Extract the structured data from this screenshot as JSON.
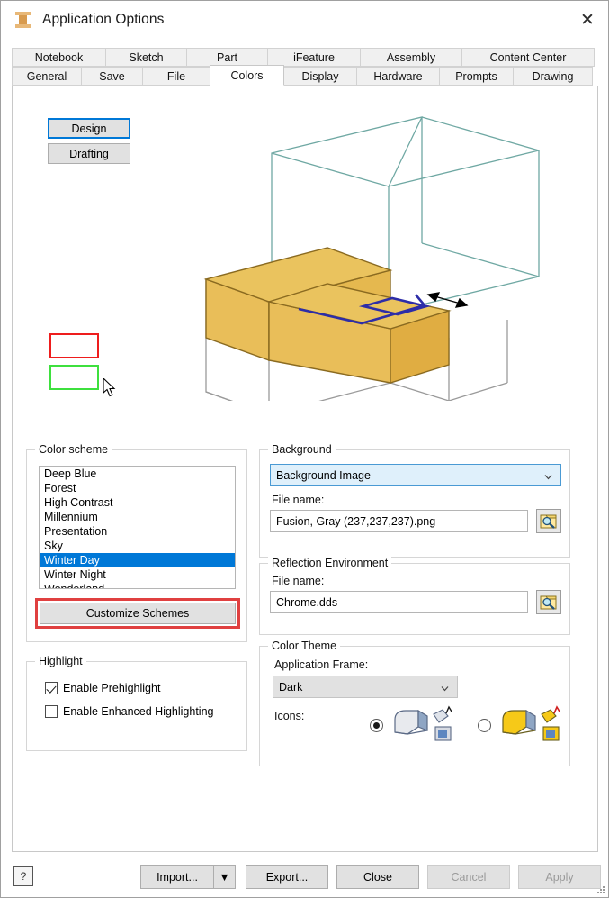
{
  "window": {
    "title": "Application Options",
    "icon": "inventor-ibeam-icon",
    "close_label": "✕"
  },
  "tabs": {
    "row1": [
      {
        "label": "Notebook",
        "active": false
      },
      {
        "label": "Sketch",
        "active": false
      },
      {
        "label": "Part",
        "active": false
      },
      {
        "label": "iFeature",
        "active": false
      },
      {
        "label": "Assembly",
        "active": false
      },
      {
        "label": "Content Center",
        "active": false
      }
    ],
    "row2": [
      {
        "label": "General",
        "active": false
      },
      {
        "label": "Save",
        "active": false
      },
      {
        "label": "File",
        "active": false
      },
      {
        "label": "Colors",
        "active": true
      },
      {
        "label": "Display",
        "active": false
      },
      {
        "label": "Hardware",
        "active": false
      },
      {
        "label": "Prompts",
        "active": false
      },
      {
        "label": "Drawing",
        "active": false
      }
    ]
  },
  "mode_buttons": {
    "design": "Design",
    "drafting": "Drafting"
  },
  "preview": {
    "solid_color": "#e9be59",
    "solid_edge_color": "#8a6a20",
    "wire_teal_color": "#6fa8a3",
    "wire_grey_color": "#9a9a9a",
    "sketch_color": "#2d2da8",
    "dimension_color": "#000000"
  },
  "swatches": {
    "prehighlight_color": "#ee1d1d",
    "highlight_color": "#3ee03e"
  },
  "color_scheme": {
    "legend": "Color scheme",
    "items": [
      "Deep Blue",
      "Forest",
      "High Contrast",
      "Millennium",
      "Presentation",
      "Sky",
      "Winter Day",
      "Winter Night",
      "Wonderland"
    ],
    "selected": "Winter Day",
    "selected_index": 6,
    "customize_button": "Customize Schemes",
    "annotation_color": "#e04040"
  },
  "highlight": {
    "legend": "Highlight",
    "enable_prehighlight": {
      "label": "Enable Prehighlight",
      "checked": true
    },
    "enable_enhanced": {
      "label": "Enable Enhanced Highlighting",
      "checked": false
    }
  },
  "background": {
    "legend": "Background",
    "mode_value": "Background Image",
    "file_label": "File name:",
    "file_value": "Fusion, Gray (237,237,237).png",
    "browse_icon": "browse-folder-magnifier-icon"
  },
  "reflection": {
    "legend": "Reflection Environment",
    "file_label": "File name:",
    "file_value": "Chrome.dds",
    "browse_icon": "browse-folder-magnifier-icon"
  },
  "color_theme": {
    "legend": "Color Theme",
    "frame_label": "Application Frame:",
    "frame_value": "Dark",
    "icons_label": "Icons:",
    "options": [
      {
        "name": "light-icons",
        "selected": true
      },
      {
        "name": "amber-icons",
        "selected": false
      }
    ]
  },
  "footer": {
    "help": "?",
    "import": "Import...",
    "import_dropdown": "▼",
    "export": "Export...",
    "close": "Close",
    "cancel": "Cancel",
    "apply": "Apply",
    "cancel_disabled": true,
    "apply_disabled": true
  }
}
